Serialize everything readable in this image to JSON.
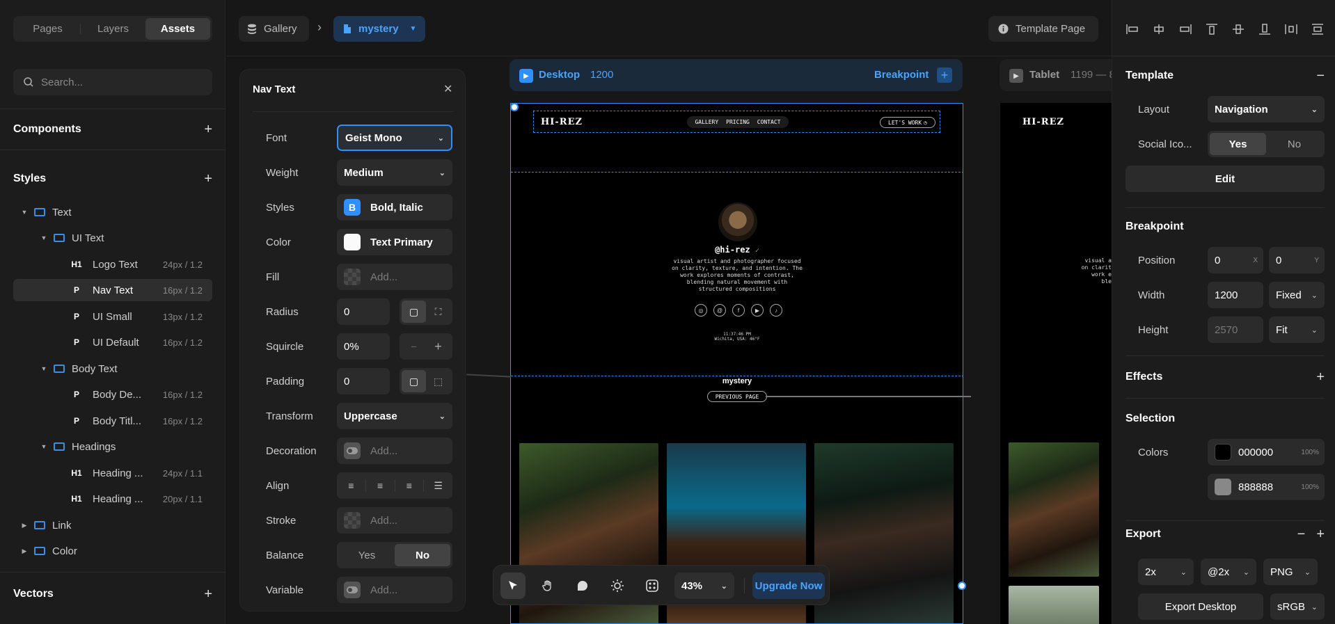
{
  "left": {
    "tabs": [
      "Pages",
      "Layers",
      "Assets"
    ],
    "search_placeholder": "Search...",
    "components_label": "Components",
    "styles_label": "Styles",
    "vectors_label": "Vectors",
    "tree": [
      {
        "label": "Text",
        "badge": "",
        "meta": ""
      },
      {
        "label": "UI Text",
        "badge": "",
        "meta": ""
      },
      {
        "label": "Logo Text",
        "badge": "H1",
        "meta": "24px / 1.2"
      },
      {
        "label": "Nav Text",
        "badge": "P",
        "meta": "16px / 1.2"
      },
      {
        "label": "UI Small",
        "badge": "P",
        "meta": "13px / 1.2"
      },
      {
        "label": "UI Default",
        "badge": "P",
        "meta": "16px / 1.2"
      },
      {
        "label": "Body Text",
        "badge": "",
        "meta": ""
      },
      {
        "label": "Body De...",
        "badge": "P",
        "meta": "16px / 1.2"
      },
      {
        "label": "Body Titl...",
        "badge": "P",
        "meta": "16px / 1.2"
      },
      {
        "label": "Headings",
        "badge": "",
        "meta": ""
      },
      {
        "label": "Heading ...",
        "badge": "H1",
        "meta": "24px / 1.1"
      },
      {
        "label": "Heading ...",
        "badge": "H1",
        "meta": "20px / 1.1"
      },
      {
        "label": "Link",
        "badge": "",
        "meta": ""
      },
      {
        "label": "Color",
        "badge": "",
        "meta": ""
      }
    ]
  },
  "topbar": {
    "gallery": "Gallery",
    "page": "mystery",
    "template_page": "Template Page"
  },
  "text_panel": {
    "title": "Nav Text",
    "labels": {
      "font": "Font",
      "weight": "Weight",
      "styles": "Styles",
      "color": "Color",
      "fill": "Fill",
      "radius": "Radius",
      "squircle": "Squircle",
      "padding": "Padding",
      "transform": "Transform",
      "decoration": "Decoration",
      "align": "Align",
      "stroke": "Stroke",
      "balance": "Balance",
      "variable": "Variable"
    },
    "font": "Geist Mono",
    "weight": "Medium",
    "styles_icon": "B",
    "styles": "Bold, Italic",
    "color": "Text Primary",
    "add": "Add...",
    "radius": "0",
    "squircle": "0%",
    "squircle_minus": "−",
    "squircle_plus": "+",
    "padding": "0",
    "transform": "Uppercase",
    "balance": [
      "Yes",
      "No"
    ]
  },
  "desktop": {
    "label": "Desktop",
    "width": "1200",
    "breakpoint": "Breakpoint",
    "breakpoint_plus": "+"
  },
  "tablet": {
    "label": "Tablet",
    "range": "1199 — 8"
  },
  "site": {
    "logo": "HI-REZ",
    "nav": [
      "GALLERY",
      "PRICING",
      "CONTACT"
    ],
    "cta": "LET'S WORK",
    "handle": "@hi-rez",
    "bio": [
      "visual artist and photographer focused",
      "on clarity, texture, and intention. The",
      "work explores moments of contrast,",
      "blending natural movement with",
      "structured compositions"
    ],
    "time": "11:37:46 PM",
    "location": "Wichita, USA: 46°F",
    "page_title": "mystery",
    "prev": "PREVIOUS PAGE",
    "tablet_bio": [
      "visual a",
      "on clarit",
      "work e",
      "ble"
    ]
  },
  "toolbar": {
    "zoom": "43%",
    "upgrade": "Upgrade Now"
  },
  "right": {
    "template": "Template",
    "template_minus": "−",
    "layout_label": "Layout",
    "layout": "Navigation",
    "social_label": "Social Ico...",
    "social": [
      "Yes",
      "No"
    ],
    "edit": "Edit",
    "breakpoint": "Breakpoint",
    "position_label": "Position",
    "pos_x": "0",
    "pos_x_axis": "X",
    "pos_y": "0",
    "pos_y_axis": "Y",
    "width_label": "Width",
    "width": "1200",
    "width_mode": "Fixed",
    "height_label": "Height",
    "height": "2570",
    "height_mode": "Fit",
    "effects": "Effects",
    "selection": "Selection",
    "colors_label": "Colors",
    "colors": [
      {
        "hex": "000000",
        "opacity": "100%",
        "swatch": "#000000"
      },
      {
        "hex": "888888",
        "opacity": "100%",
        "swatch": "#888888"
      }
    ],
    "export": "Export",
    "export_minus": "−",
    "export_plus": "+",
    "scale": "2x",
    "suffix": "@2x",
    "format": "PNG",
    "export_button": "Export Desktop",
    "profile": "sRGB"
  },
  "theme": {
    "accent": "#2e90ff",
    "bg": "#141414",
    "panel": "#1c1c1c"
  }
}
